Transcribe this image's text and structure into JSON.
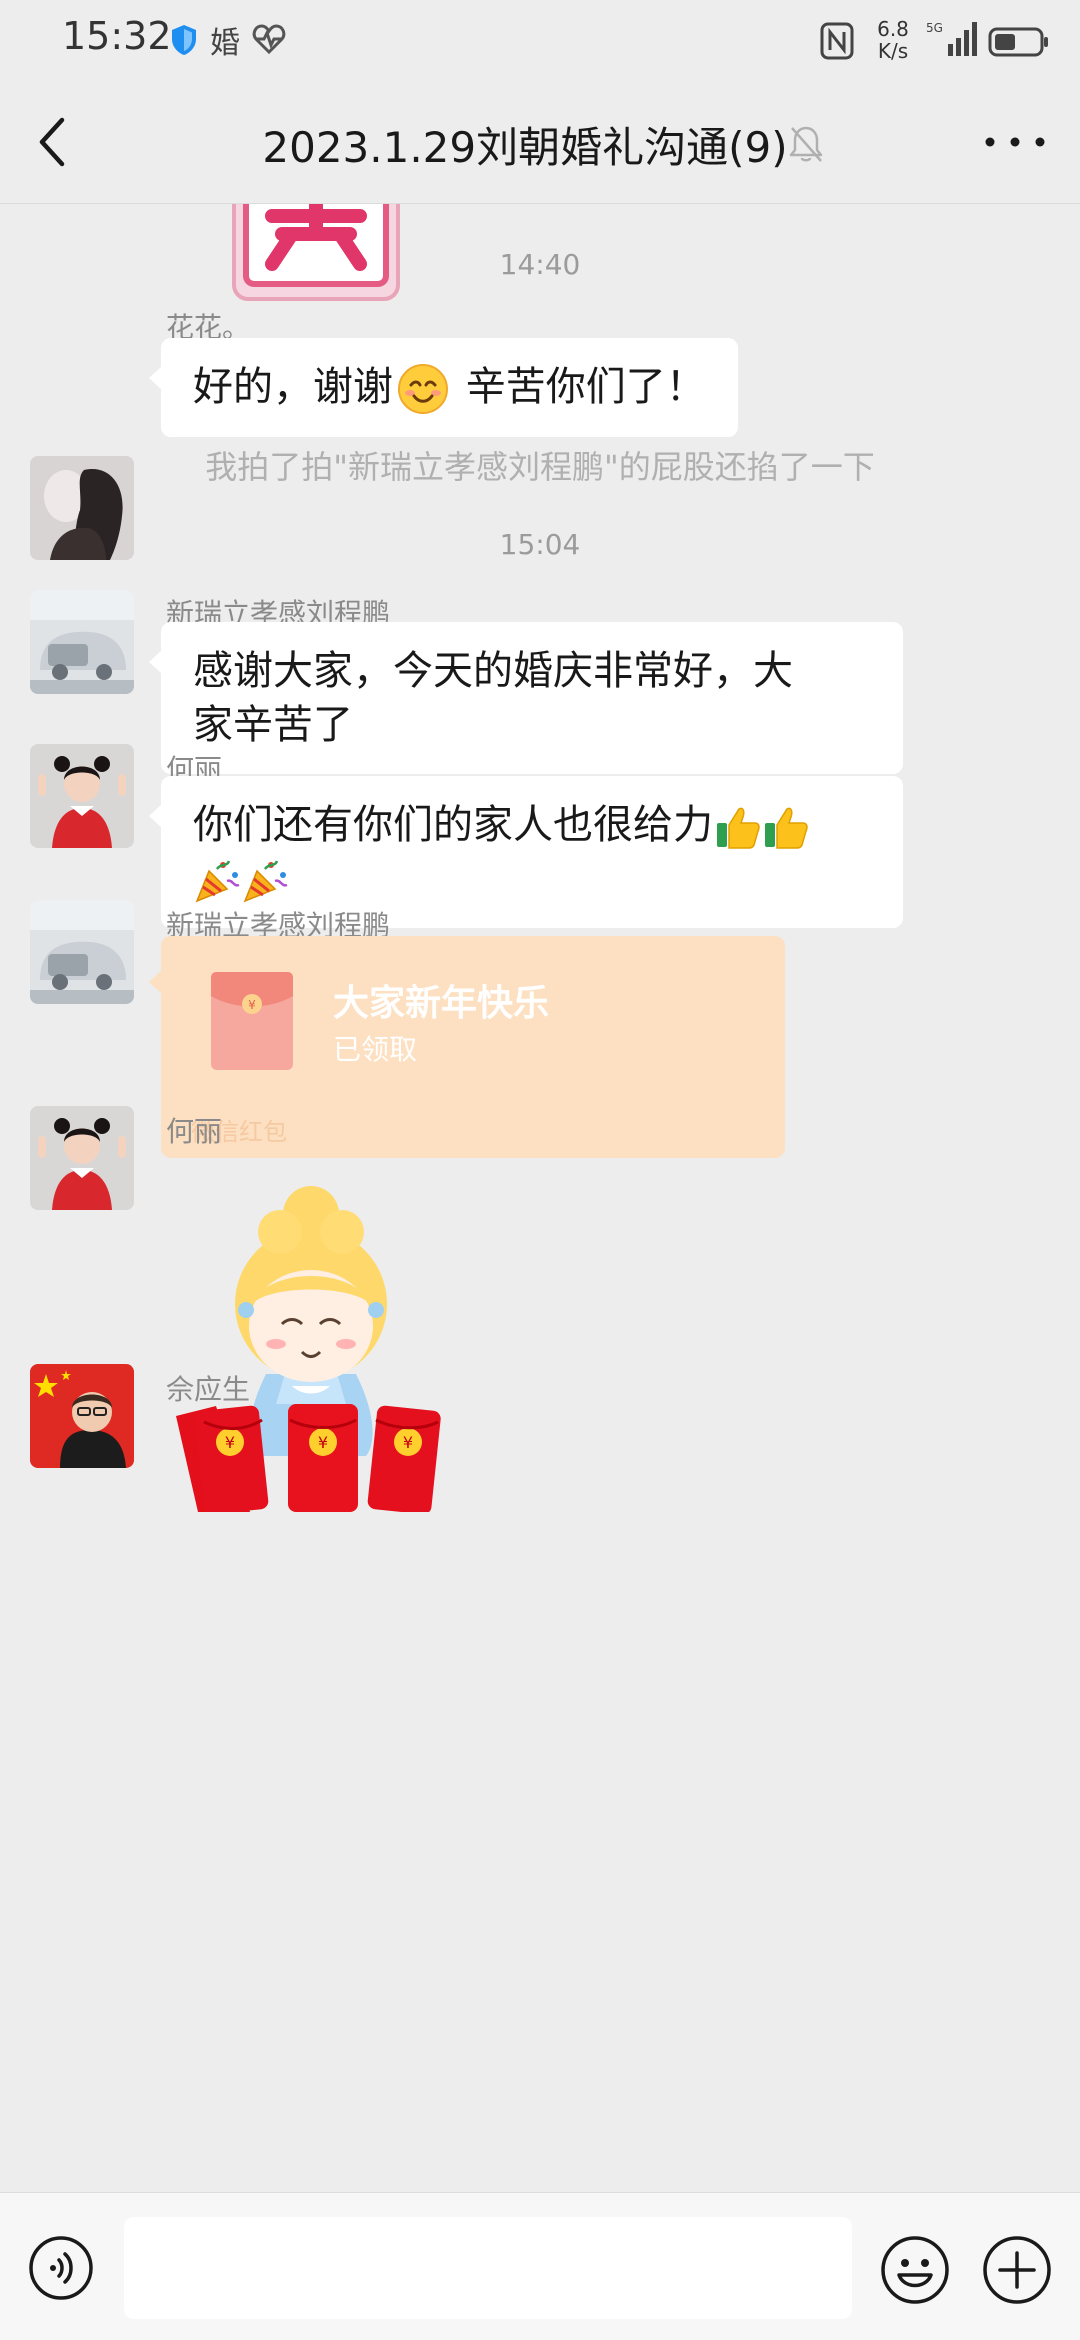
{
  "status_bar": {
    "time": "15:32",
    "app_badge": "婚",
    "speed_value": "6.8",
    "speed_unit": "K/s",
    "network": "5G"
  },
  "header": {
    "title": "2023.1.29刘朝婚礼沟通(9)",
    "icons": [
      "back-arrow-icon",
      "bell-muted-icon",
      "more-icon"
    ]
  },
  "chat": {
    "timestamps": [
      "14:40",
      "15:04"
    ],
    "messages": [
      {
        "sender": "花花。",
        "text": "好的，谢谢",
        "text_after_emoji": " 辛苦你们了！",
        "emoji": "smiling-face"
      },
      {
        "system": "我拍了拍\"新瑞立孝感刘程鹏\"的屁股还掐了一下"
      },
      {
        "sender": "新瑞立孝感刘程鹏",
        "line1": "感谢大家，今天的婚庆非常好，大",
        "line2": "家辛苦了"
      },
      {
        "sender": "何丽",
        "text": "你们还有你们的家人也很给力",
        "emojis": [
          "thumbs-up",
          "thumbs-up",
          "party-popper",
          "party-popper"
        ]
      },
      {
        "sender": "新瑞立孝感刘程鹏",
        "type": "red_packet",
        "title": "大家新年快乐",
        "status": "已领取",
        "footer": "微信红包"
      },
      {
        "sender": "何丽",
        "type": "sticker",
        "sticker": "cartoon-girl"
      },
      {
        "sender": "佘应生",
        "type": "sticker",
        "sticker": "red-envelopes"
      }
    ]
  },
  "colors": {
    "background": "#ededed",
    "bubble": "#ffffff",
    "red_packet_bg": "#fde0c1",
    "red_packet_icon": "#f24b40"
  },
  "input_bar": {
    "placeholder": ""
  }
}
